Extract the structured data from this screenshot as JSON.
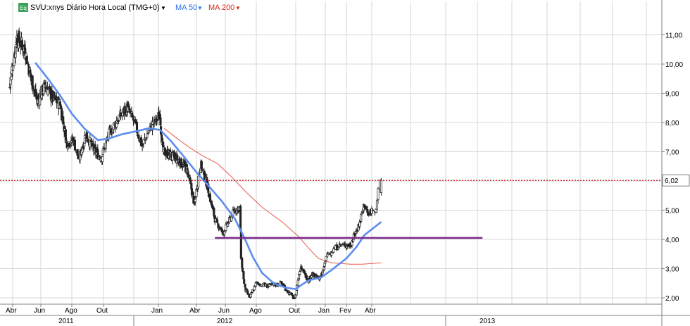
{
  "header": {
    "symbol_badge": "Eq",
    "symbol_label": "SVU:xnys Diário Hora Local (TMG+0)",
    "ma50_label": "MA 50",
    "ma200_label": "MA 200"
  },
  "colors": {
    "background": "#ffffff",
    "candle": "#222222",
    "ma50": "#5b8def",
    "ma200": "#e85b50",
    "last_price_line": "#cc0000",
    "support_line": "#7a2a8a",
    "grid": "#d7d7d7",
    "badge": "#3aa35a"
  },
  "chart_data": {
    "type": "candlestick",
    "x_axis": {
      "months": [
        "Abr",
        "Jun",
        "Ago",
        "Out",
        "Jan",
        "Abr",
        "Jun",
        "Ago",
        "Out",
        "Jan",
        "Fev",
        "Abr"
      ],
      "years": [
        "2011",
        "2012",
        "2013"
      ]
    },
    "y_axis": {
      "ylim": [
        1.6,
        12.2
      ],
      "ticks": [
        "2,00",
        "3,00",
        "4,00",
        "5,00",
        "6,00",
        "7,00",
        "8,00",
        "9,00",
        "10,00",
        "11,00"
      ]
    },
    "last_price": "6,02",
    "last_price_value": 6.02,
    "support_level": 4.05,
    "close_path": [
      [
        "2011-03-25",
        9.2
      ],
      [
        "2011-04-10",
        10.9
      ],
      [
        "2011-04-28",
        10.5
      ],
      [
        "2011-05-10",
        9.6
      ],
      [
        "2011-05-25",
        8.7
      ],
      [
        "2011-06-10",
        9.3
      ],
      [
        "2011-06-22",
        8.9
      ],
      [
        "2011-07-10",
        8.6
      ],
      [
        "2011-07-22",
        7.3
      ],
      [
        "2011-08-05",
        7.4
      ],
      [
        "2011-08-15",
        6.7
      ],
      [
        "2011-08-28",
        7.6
      ],
      [
        "2011-09-15",
        7.0
      ],
      [
        "2011-09-28",
        6.8
      ],
      [
        "2011-10-10",
        7.6
      ],
      [
        "2011-10-25",
        8.1
      ],
      [
        "2011-11-10",
        8.5
      ],
      [
        "2011-11-22",
        8.0
      ],
      [
        "2011-12-05",
        7.2
      ],
      [
        "2011-12-18",
        7.8
      ],
      [
        "2012-01-05",
        8.3
      ],
      [
        "2012-01-12",
        7.0
      ],
      [
        "2012-01-28",
        6.9
      ],
      [
        "2012-02-20",
        6.7
      ],
      [
        "2012-03-10",
        6.4
      ],
      [
        "2012-03-28",
        5.2
      ],
      [
        "2012-04-10",
        6.6
      ],
      [
        "2012-04-25",
        5.8
      ],
      [
        "2012-05-10",
        4.7
      ],
      [
        "2012-05-28",
        4.2
      ],
      [
        "2012-06-05",
        4.5
      ],
      [
        "2012-06-20",
        5.0
      ],
      [
        "2012-06-30",
        5.1
      ],
      [
        "2012-07-03",
        3.3
      ],
      [
        "2012-07-10",
        2.3
      ],
      [
        "2012-07-20",
        2.0
      ],
      [
        "2012-08-01",
        2.5
      ],
      [
        "2012-08-20",
        2.4
      ],
      [
        "2012-09-10",
        2.5
      ],
      [
        "2012-09-20",
        2.2
      ],
      [
        "2012-09-30",
        1.95
      ],
      [
        "2012-10-10",
        2.7
      ],
      [
        "2012-10-18",
        3.1
      ],
      [
        "2012-10-30",
        2.8
      ],
      [
        "2012-11-10",
        2.6
      ],
      [
        "2012-11-22",
        2.8
      ],
      [
        "2012-12-05",
        2.7
      ],
      [
        "2012-12-18",
        2.7
      ],
      [
        "2012-12-28",
        3.0
      ],
      [
        "2013-01-05",
        3.5
      ],
      [
        "2013-01-22",
        3.8
      ],
      [
        "2013-02-10",
        3.8
      ],
      [
        "2013-02-22",
        4.2
      ],
      [
        "2013-03-05",
        4.6
      ],
      [
        "2013-03-15",
        5.2
      ],
      [
        "2013-03-25",
        4.8
      ],
      [
        "2013-04-05",
        5.1
      ],
      [
        "2013-04-10",
        6.02
      ]
    ],
    "series": [
      {
        "name": "MA 50",
        "points": [
          [
            "2011-05-20",
            10.05
          ],
          [
            "2011-06-15",
            9.5
          ],
          [
            "2011-07-10",
            8.9
          ],
          [
            "2011-08-01",
            8.3
          ],
          [
            "2011-08-25",
            7.8
          ],
          [
            "2011-09-20",
            7.4
          ],
          [
            "2011-10-10",
            7.45
          ],
          [
            "2011-11-01",
            7.6
          ],
          [
            "2011-11-25",
            7.7
          ],
          [
            "2011-12-15",
            7.8
          ],
          [
            "2012-01-05",
            7.75
          ],
          [
            "2012-02-01",
            7.35
          ],
          [
            "2012-03-01",
            6.85
          ],
          [
            "2012-04-01",
            6.3
          ],
          [
            "2012-05-01",
            5.75
          ],
          [
            "2012-05-25",
            5.3
          ],
          [
            "2012-06-20",
            4.7
          ],
          [
            "2012-07-10",
            4.0
          ],
          [
            "2012-07-25",
            3.4
          ],
          [
            "2012-08-10",
            2.85
          ],
          [
            "2012-08-28",
            2.5
          ],
          [
            "2012-09-15",
            2.35
          ],
          [
            "2012-10-01",
            2.3
          ],
          [
            "2012-10-20",
            2.45
          ],
          [
            "2012-11-10",
            2.6
          ],
          [
            "2012-12-01",
            2.65
          ],
          [
            "2012-12-20",
            2.7
          ],
          [
            "2013-01-10",
            2.95
          ],
          [
            "2013-02-01",
            3.35
          ],
          [
            "2013-02-25",
            3.75
          ],
          [
            "2013-03-15",
            4.15
          ],
          [
            "2013-04-10",
            4.6
          ]
        ]
      },
      {
        "name": "MA 200",
        "points": [
          [
            "2012-01-15",
            7.8
          ],
          [
            "2012-02-15",
            7.45
          ],
          [
            "2012-03-15",
            7.15
          ],
          [
            "2012-04-15",
            6.85
          ],
          [
            "2012-05-15",
            6.6
          ],
          [
            "2012-06-10",
            6.2
          ],
          [
            "2012-07-10",
            5.65
          ],
          [
            "2012-08-10",
            5.1
          ],
          [
            "2012-09-10",
            4.6
          ],
          [
            "2012-10-10",
            4.1
          ],
          [
            "2012-11-10",
            3.7
          ],
          [
            "2012-12-10",
            3.35
          ],
          [
            "2013-01-10",
            3.2
          ],
          [
            "2013-02-10",
            3.15
          ],
          [
            "2013-03-10",
            3.15
          ],
          [
            "2013-04-10",
            3.2
          ]
        ]
      }
    ],
    "grid": true
  }
}
